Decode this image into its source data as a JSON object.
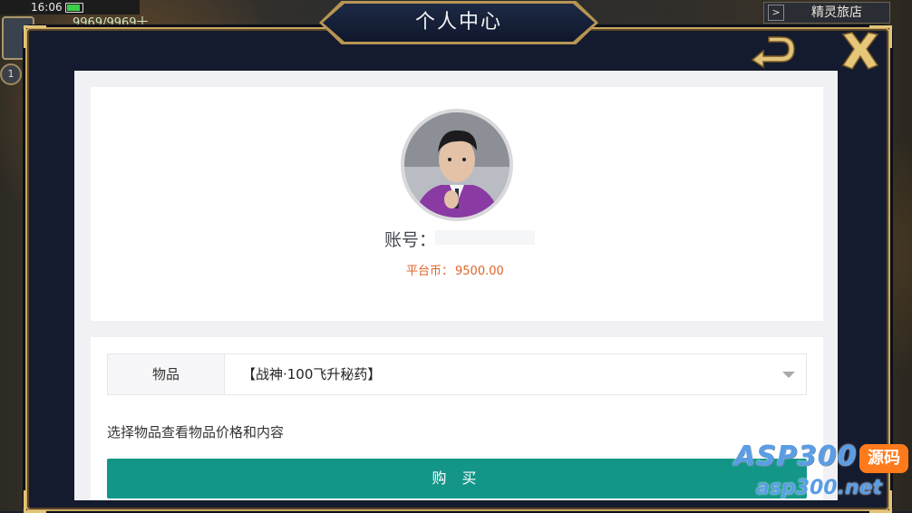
{
  "status_bar": {
    "time": "16:06"
  },
  "hud": {
    "resource_counter": "9969/9969十",
    "level_badge": "1"
  },
  "inn_button": {
    "arrow": ">",
    "label": "精灵旅店"
  },
  "modal": {
    "title": "个人中心",
    "back_icon": "back-arrow-icon",
    "close_icon": "close-icon"
  },
  "profile": {
    "account_label": "账号：",
    "account_value": "",
    "currency_label": "平台币：",
    "currency_value": "9500.00"
  },
  "purchase_form": {
    "item_label": "物品",
    "item_selected": "【战神·100飞升秘药】",
    "hint": "选择物品查看物品价格和内容",
    "buy_label": "购 买"
  },
  "watermark": {
    "top": "ASP300",
    "tag": "源码",
    "bottom": "asp300.net"
  },
  "colors": {
    "accent_teal": "#139688",
    "currency_orange": "#e0642a",
    "frame_gold": "#c9a862",
    "modal_navy": "#141b2e"
  }
}
